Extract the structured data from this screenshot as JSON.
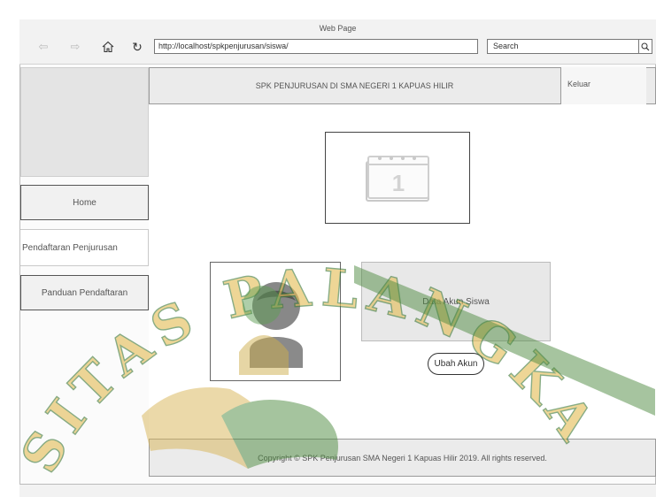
{
  "browser": {
    "window_title": "Web Page",
    "url": "http://localhost/spkpenjurusan/siswa/",
    "search_placeholder": "Search"
  },
  "header": {
    "title": "SPK PENJURUSAN DI SMA NEGERI 1 KAPUAS HILIR",
    "logout_label": "Keluar"
  },
  "sidebar": {
    "items": [
      {
        "label": "Home"
      },
      {
        "label": "Pendaftaran Penjurusan"
      },
      {
        "label": "Panduan Pendaftaran"
      }
    ]
  },
  "main": {
    "calendar_number": "1",
    "data_box_label": "Data Akun Siswa",
    "edit_button_label": "Ubah Akun"
  },
  "footer": {
    "copyright": "Copyright © SPK Penjurusan SMA Negeri 1 Kapuas Hilir 2019. All rights reserved."
  },
  "watermark": {
    "text": "SITAS PALANGKA",
    "color": "#e4bd57"
  }
}
